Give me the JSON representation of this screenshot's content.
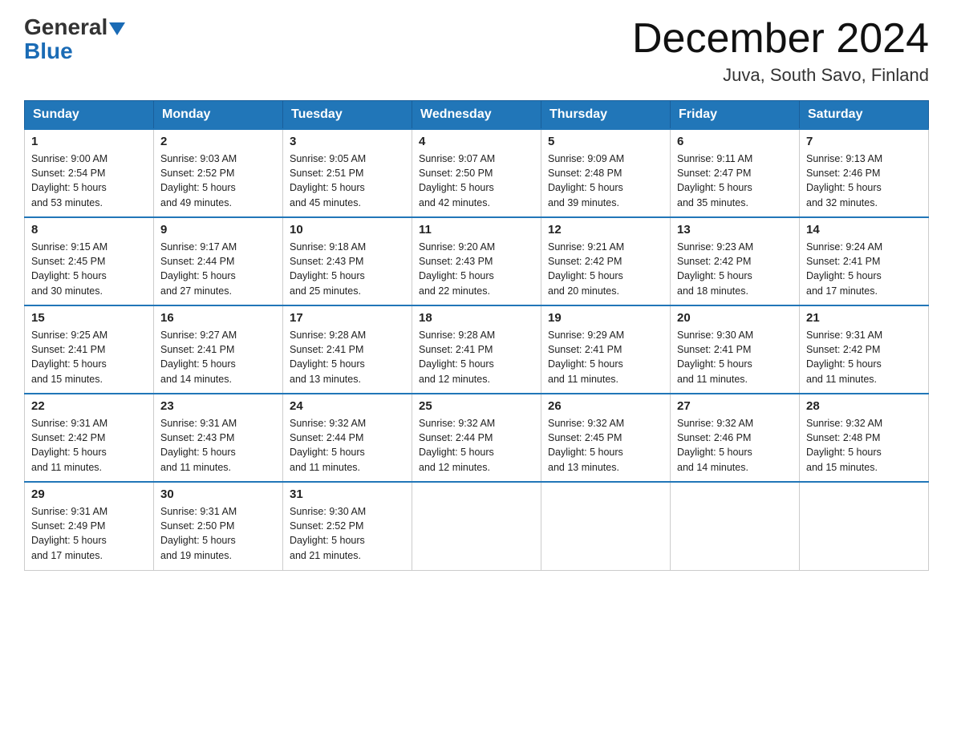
{
  "header": {
    "logo_general": "General",
    "logo_blue": "Blue",
    "month_title": "December 2024",
    "location": "Juva, South Savo, Finland"
  },
  "days_of_week": [
    "Sunday",
    "Monday",
    "Tuesday",
    "Wednesday",
    "Thursday",
    "Friday",
    "Saturday"
  ],
  "weeks": [
    [
      {
        "day": "1",
        "sunrise": "9:00 AM",
        "sunset": "2:54 PM",
        "daylight": "5 hours and 53 minutes."
      },
      {
        "day": "2",
        "sunrise": "9:03 AM",
        "sunset": "2:52 PM",
        "daylight": "5 hours and 49 minutes."
      },
      {
        "day": "3",
        "sunrise": "9:05 AM",
        "sunset": "2:51 PM",
        "daylight": "5 hours and 45 minutes."
      },
      {
        "day": "4",
        "sunrise": "9:07 AM",
        "sunset": "2:50 PM",
        "daylight": "5 hours and 42 minutes."
      },
      {
        "day": "5",
        "sunrise": "9:09 AM",
        "sunset": "2:48 PM",
        "daylight": "5 hours and 39 minutes."
      },
      {
        "day": "6",
        "sunrise": "9:11 AM",
        "sunset": "2:47 PM",
        "daylight": "5 hours and 35 minutes."
      },
      {
        "day": "7",
        "sunrise": "9:13 AM",
        "sunset": "2:46 PM",
        "daylight": "5 hours and 32 minutes."
      }
    ],
    [
      {
        "day": "8",
        "sunrise": "9:15 AM",
        "sunset": "2:45 PM",
        "daylight": "5 hours and 30 minutes."
      },
      {
        "day": "9",
        "sunrise": "9:17 AM",
        "sunset": "2:44 PM",
        "daylight": "5 hours and 27 minutes."
      },
      {
        "day": "10",
        "sunrise": "9:18 AM",
        "sunset": "2:43 PM",
        "daylight": "5 hours and 25 minutes."
      },
      {
        "day": "11",
        "sunrise": "9:20 AM",
        "sunset": "2:43 PM",
        "daylight": "5 hours and 22 minutes."
      },
      {
        "day": "12",
        "sunrise": "9:21 AM",
        "sunset": "2:42 PM",
        "daylight": "5 hours and 20 minutes."
      },
      {
        "day": "13",
        "sunrise": "9:23 AM",
        "sunset": "2:42 PM",
        "daylight": "5 hours and 18 minutes."
      },
      {
        "day": "14",
        "sunrise": "9:24 AM",
        "sunset": "2:41 PM",
        "daylight": "5 hours and 17 minutes."
      }
    ],
    [
      {
        "day": "15",
        "sunrise": "9:25 AM",
        "sunset": "2:41 PM",
        "daylight": "5 hours and 15 minutes."
      },
      {
        "day": "16",
        "sunrise": "9:27 AM",
        "sunset": "2:41 PM",
        "daylight": "5 hours and 14 minutes."
      },
      {
        "day": "17",
        "sunrise": "9:28 AM",
        "sunset": "2:41 PM",
        "daylight": "5 hours and 13 minutes."
      },
      {
        "day": "18",
        "sunrise": "9:28 AM",
        "sunset": "2:41 PM",
        "daylight": "5 hours and 12 minutes."
      },
      {
        "day": "19",
        "sunrise": "9:29 AM",
        "sunset": "2:41 PM",
        "daylight": "5 hours and 11 minutes."
      },
      {
        "day": "20",
        "sunrise": "9:30 AM",
        "sunset": "2:41 PM",
        "daylight": "5 hours and 11 minutes."
      },
      {
        "day": "21",
        "sunrise": "9:31 AM",
        "sunset": "2:42 PM",
        "daylight": "5 hours and 11 minutes."
      }
    ],
    [
      {
        "day": "22",
        "sunrise": "9:31 AM",
        "sunset": "2:42 PM",
        "daylight": "5 hours and 11 minutes."
      },
      {
        "day": "23",
        "sunrise": "9:31 AM",
        "sunset": "2:43 PM",
        "daylight": "5 hours and 11 minutes."
      },
      {
        "day": "24",
        "sunrise": "9:32 AM",
        "sunset": "2:44 PM",
        "daylight": "5 hours and 11 minutes."
      },
      {
        "day": "25",
        "sunrise": "9:32 AM",
        "sunset": "2:44 PM",
        "daylight": "5 hours and 12 minutes."
      },
      {
        "day": "26",
        "sunrise": "9:32 AM",
        "sunset": "2:45 PM",
        "daylight": "5 hours and 13 minutes."
      },
      {
        "day": "27",
        "sunrise": "9:32 AM",
        "sunset": "2:46 PM",
        "daylight": "5 hours and 14 minutes."
      },
      {
        "day": "28",
        "sunrise": "9:32 AM",
        "sunset": "2:48 PM",
        "daylight": "5 hours and 15 minutes."
      }
    ],
    [
      {
        "day": "29",
        "sunrise": "9:31 AM",
        "sunset": "2:49 PM",
        "daylight": "5 hours and 17 minutes."
      },
      {
        "day": "30",
        "sunrise": "9:31 AM",
        "sunset": "2:50 PM",
        "daylight": "5 hours and 19 minutes."
      },
      {
        "day": "31",
        "sunrise": "9:30 AM",
        "sunset": "2:52 PM",
        "daylight": "5 hours and 21 minutes."
      },
      null,
      null,
      null,
      null
    ]
  ],
  "labels": {
    "sunrise": "Sunrise:",
    "sunset": "Sunset:",
    "daylight": "Daylight:"
  }
}
